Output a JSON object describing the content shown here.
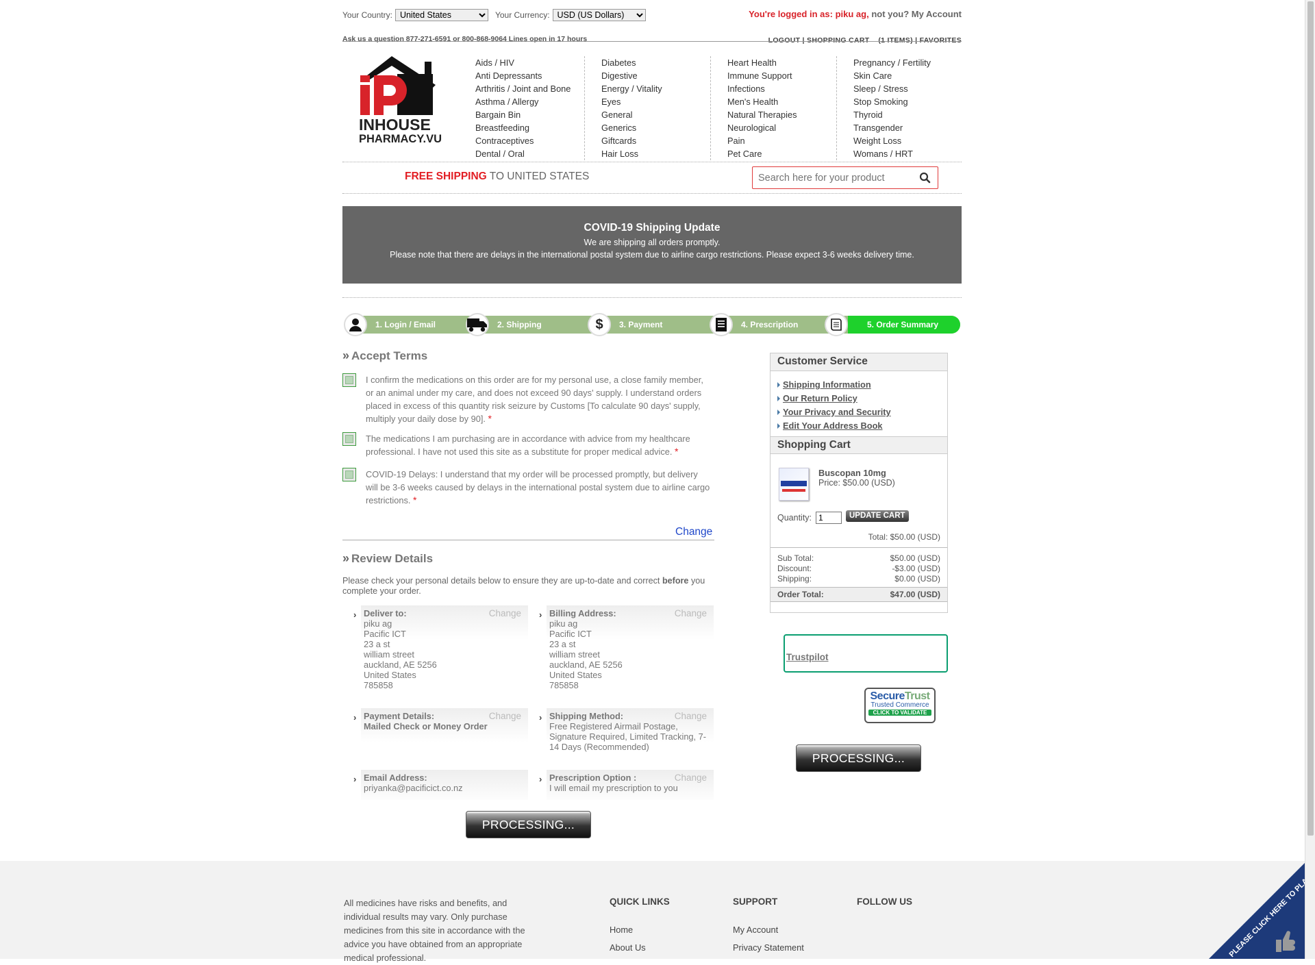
{
  "topbar": {
    "country_label": "Your Country:",
    "country_value": "United States",
    "currency_label": "Your Currency:",
    "currency_value": "USD (US Dollars)",
    "logged_prefix": "You're logged in as:",
    "logged_user": "piku ag,",
    "logged_suffix": "not you? My Account",
    "ask_line": "Ask us a question 877-271-6591 or 800-868-9064  Lines open in 17 hours",
    "links": [
      "LOGOUT",
      "SHOPPING CART",
      "(1 ITEMS)",
      "FAVORITES"
    ]
  },
  "logo": {
    "line1": "INHOUSE",
    "line2": "PHARMACY.VU"
  },
  "categories": [
    [
      "Aids / HIV",
      "Anti Depressants",
      "Arthritis / Joint and Bone",
      "Asthma / Allergy",
      "Bargain Bin",
      "Breastfeeding",
      "Contraceptives",
      "Dental / Oral"
    ],
    [
      "Diabetes",
      "Digestive",
      "Energy / Vitality",
      "Eyes",
      "General",
      "Generics",
      "Giftcards",
      "Hair Loss"
    ],
    [
      "Heart Health",
      "Immune Support",
      "Infections",
      "Men's Health",
      "Natural Therapies",
      "Neurological",
      "Pain",
      "Pet Care"
    ],
    [
      "Pregnancy / Fertility",
      "Skin Care",
      "Sleep / Stress",
      "Stop Smoking",
      "Thyroid",
      "Transgender",
      "Weight Loss",
      "Womans / HRT"
    ]
  ],
  "shipping_banner": {
    "free": "FREE SHIPPING",
    "rest": "TO UNITED STATES"
  },
  "search": {
    "placeholder": "Search here for your product"
  },
  "covid": {
    "title": "COVID-19 Shipping Update",
    "line1": "We are shipping all orders promptly.",
    "line2": "Please note that there are delays in the international postal system due to airline cargo restrictions. Please expect 3-6 weeks delivery time."
  },
  "steps": [
    "1. Login / Email",
    "2. Shipping",
    "3. Payment",
    "4. Prescription",
    "5. Order Summary"
  ],
  "accept_terms": {
    "title": "Accept Terms",
    "terms": [
      "I confirm the medications on this order are for my personal use, a close family member, or an animal under my care, and does not exceed 90 days' supply. I understand orders placed in excess of this quantity risk seizure by Customs [To calculate 90 days' supply, multiply your daily dose by 90].",
      "The medications I am purchasing are in accordance with advice from my healthcare professional. I have not used this site as a substitute for proper medical advice.",
      "COVID-19 Delays: I understand that my order will be processed promptly, but delivery will be 3-6 weeks caused by delays in the international postal system due to airline cargo restrictions."
    ],
    "change": "Change"
  },
  "review": {
    "title": "Review Details",
    "intro": "Please check your personal details below to ensure they are up-to-date and correct",
    "intro_bold": "before",
    "intro_end": "you complete your order.",
    "change": "Change",
    "deliver_to": {
      "label": "Deliver to:",
      "lines": [
        "piku ag",
        "Pacific ICT",
        "23 a st",
        "william street",
        "auckland, AE 5256",
        "United States",
        "785858"
      ]
    },
    "billing": {
      "label": "Billing Address:",
      "lines": [
        "piku ag",
        "Pacific ICT",
        "23 a st",
        "william street",
        "auckland, AE 5256",
        "United States",
        "785858"
      ]
    },
    "payment": {
      "label": "Payment Details:",
      "value": "Mailed Check or Money Order"
    },
    "shipping_method": {
      "label": "Shipping Method:",
      "value": "Free Registered Airmail Postage, Signature Required, Limited Tracking, 7-14 Days (Recommended)"
    },
    "email": {
      "label": "Email Address:",
      "value": "priyanka@pacificict.co.nz"
    },
    "prescription": {
      "label": "Prescription Option :",
      "value": "I will email my prescription to you"
    },
    "processing": "PROCESSING..."
  },
  "customer_service": {
    "title": "Customer Service",
    "links": [
      "Shipping Information",
      "Our Return Policy",
      "Your Privacy and Security",
      "Edit Your Address Book"
    ]
  },
  "cart": {
    "title": "Shopping Cart",
    "product_name": "Buscopan 10mg",
    "product_price": "Price: $50.00 (USD)",
    "quantity_label": "Quantity:",
    "quantity_value": "1",
    "update_button": "UPDATE CART",
    "total": "Total: $50.00 (USD)",
    "subtotal_label": "Sub Total:",
    "subtotal": "$50.00 (USD)",
    "discount_label": "Discount:",
    "discount": "-$3.00 (USD)",
    "shipping_label": "Shipping:",
    "shipping": "$0.00 (USD)",
    "order_total_label": "Order Total:",
    "order_total": "$47.00 (USD)",
    "processing": "PROCESSING..."
  },
  "trustpilot": "Trustpilot",
  "securetrust": {
    "l1a": "Secure",
    "l1b": "Trust",
    "l2": "Trusted Commerce",
    "l3": "CLICK TO VALIDATE"
  },
  "footer": {
    "disclaimer": "All medicines have risks and benefits, and individual results may vary. Only purchase medicines from this site in accordance with the advice you have obtained from an appropriate medical professional.",
    "quick_links_title": "QUICK LINKS",
    "quick_links": [
      "Home",
      "About Us"
    ],
    "support_title": "SUPPORT",
    "support": [
      "My Account",
      "Privacy Statement"
    ],
    "follow_title": "FOLLOW US",
    "feedback": "PLEASE CLICK HERE TO PLACE FEEDBACK"
  },
  "colors": {
    "accent_red": "#e21d23",
    "step_green": "#1ed12c",
    "step_inactive": "#9fbe88",
    "covid_bg": "#666666"
  }
}
